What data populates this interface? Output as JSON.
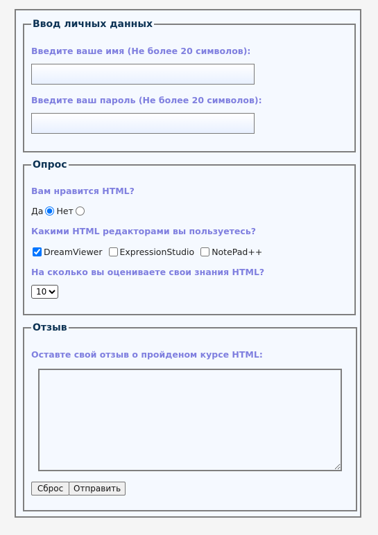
{
  "personal": {
    "legend": "Ввод личных данных",
    "name_label": "Введите ваше имя (Не более 20 символов):",
    "name_value": "",
    "password_label": "Введите ваш пароль (Не более 20 символов):",
    "password_value": ""
  },
  "survey": {
    "legend": "Опрос",
    "like_question": "Вам нравится HTML?",
    "like_options": [
      {
        "label": "Да",
        "checked": true
      },
      {
        "label": "Нет",
        "checked": false
      }
    ],
    "editors_question": "Какими HTML редакторами вы пользуетесь?",
    "editors": [
      {
        "label": "DreamViewer",
        "checked": true
      },
      {
        "label": "ExpressionStudio",
        "checked": false
      },
      {
        "label": "NotePad++",
        "checked": false
      }
    ],
    "rating_question": "На сколько вы оцениваете свои знания HTML?",
    "rating_selected": "10"
  },
  "feedback": {
    "legend": "Отзыв",
    "label": "Оставте свой отзыв о пройденом курсе HTML:",
    "value": "",
    "reset_label": "Сброс",
    "submit_label": "Отправить"
  }
}
